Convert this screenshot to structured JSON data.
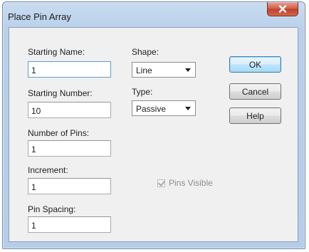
{
  "window": {
    "title": "Place Pin Array",
    "close_glyph": "✕"
  },
  "fields": {
    "starting_name": {
      "label": "Starting Name:",
      "value": "1"
    },
    "starting_number": {
      "label": "Starting Number:",
      "value": "10"
    },
    "number_of_pins": {
      "label": "Number of Pins:",
      "value": "1"
    },
    "increment": {
      "label": "Increment:",
      "value": "1"
    },
    "pin_spacing": {
      "label": "Pin Spacing:",
      "value": "1"
    }
  },
  "shape": {
    "label": "Shape:",
    "value": "Line"
  },
  "type": {
    "label": "Type:",
    "value": "Passive"
  },
  "buttons": {
    "ok": "OK",
    "cancel": "Cancel",
    "help": "Help"
  },
  "pins_visible": {
    "label": "Pins Visible",
    "checked": true,
    "enabled": false
  },
  "colors": {
    "close_button": "#c7432e",
    "client_bg": "#f0f0f0",
    "frame": "#b9d0ea",
    "focus_border": "#5c9ccf"
  }
}
